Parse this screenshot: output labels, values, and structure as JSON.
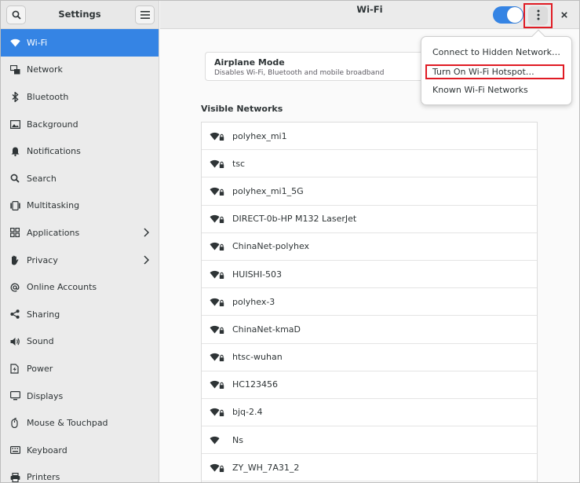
{
  "sidebar": {
    "title": "Settings",
    "search_icon": "search-icon",
    "menu_icon": "hamburger-icon",
    "items": [
      {
        "label": "Wi-Fi",
        "icon": "wifi-icon",
        "active": true
      },
      {
        "label": "Network",
        "icon": "network-icon"
      },
      {
        "label": "Bluetooth",
        "icon": "bluetooth-icon"
      },
      {
        "label": "Background",
        "icon": "background-icon"
      },
      {
        "label": "Notifications",
        "icon": "bell-icon"
      },
      {
        "label": "Search",
        "icon": "search-icon"
      },
      {
        "label": "Multitasking",
        "icon": "multitasking-icon"
      },
      {
        "label": "Applications",
        "icon": "applications-icon",
        "chevron": true
      },
      {
        "label": "Privacy",
        "icon": "hand-icon",
        "chevron": true
      },
      {
        "label": "Online Accounts",
        "icon": "at-icon"
      },
      {
        "label": "Sharing",
        "icon": "share-icon"
      },
      {
        "label": "Sound",
        "icon": "speaker-icon"
      },
      {
        "label": "Power",
        "icon": "power-icon"
      },
      {
        "label": "Displays",
        "icon": "display-icon"
      },
      {
        "label": "Mouse & Touchpad",
        "icon": "mouse-icon"
      },
      {
        "label": "Keyboard",
        "icon": "keyboard-icon"
      },
      {
        "label": "Printers",
        "icon": "printer-icon"
      }
    ]
  },
  "header": {
    "title": "Wi-Fi",
    "toggle_on": true,
    "menu_icon": "vertical-dots-icon",
    "close_icon": "close-icon"
  },
  "airplane": {
    "title": "Airplane Mode",
    "subtitle": "Disables Wi-Fi, Bluetooth and mobile broadband"
  },
  "networks": {
    "heading": "Visible Networks",
    "items": [
      {
        "name": "polyhex_mi1",
        "secured": true
      },
      {
        "name": "tsc",
        "secured": true
      },
      {
        "name": "polyhex_mi1_5G",
        "secured": true
      },
      {
        "name": "DIRECT-0b-HP M132 LaserJet",
        "secured": true
      },
      {
        "name": "ChinaNet-polyhex",
        "secured": true
      },
      {
        "name": "HUISHI-503",
        "secured": true
      },
      {
        "name": "polyhex-3",
        "secured": true
      },
      {
        "name": "ChinaNet-kmaD",
        "secured": true
      },
      {
        "name": "htsc-wuhan",
        "secured": true
      },
      {
        "name": "HC123456",
        "secured": true
      },
      {
        "name": "bjq-2.4",
        "secured": true
      },
      {
        "name": "Ns",
        "secured": false
      },
      {
        "name": "ZY_WH_7A31_2",
        "secured": true
      }
    ]
  },
  "popover": {
    "items": [
      {
        "label": "Connect to Hidden Network…"
      },
      {
        "label": "Turn On Wi-Fi Hotspot…",
        "highlighted": true
      },
      {
        "label": "Known Wi-Fi Networks"
      }
    ]
  },
  "colors": {
    "accent": "#3584e4",
    "highlight_box": "#e01b24"
  }
}
